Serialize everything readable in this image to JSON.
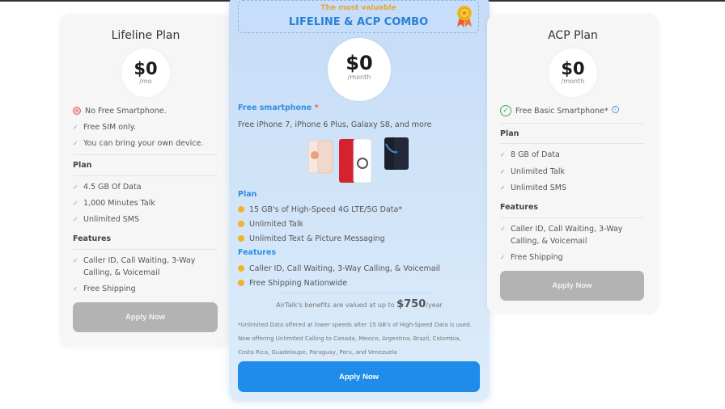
{
  "colors": {
    "accent_blue": "#1e8ce8",
    "label_blue": "#2d8ee0",
    "bullet_orange": "#f0b429",
    "banner_orange": "#e5a43a",
    "disabled_gray": "#b3b3b3",
    "no_red": "#e06060",
    "yes_green": "#3cb043"
  },
  "lifeline": {
    "title": "Lifeline Plan",
    "price": "$0",
    "unit": "/mo",
    "no_phone": "No Free Smartphone.",
    "intro_items": [
      "Free SIM only.",
      "You can bring your own device."
    ],
    "plan_label": "Plan",
    "plan_items": [
      "4.5 GB Of Data",
      "1,000 Minutes Talk",
      "Unlimited SMS"
    ],
    "features_label": "Features",
    "feature_items": [
      "Caller ID, Call Waiting, 3-Way Calling, & Voicemail",
      "Free Shipping"
    ],
    "button": "Apply Now"
  },
  "combo": {
    "banner_sub": "The most valuable",
    "banner_title": "LIFELINE & ACP COMBO",
    "price": "$0",
    "unit": "/month",
    "smartphone_label": "Free smartphone",
    "smartphone_asterisk": "*",
    "smartphone_desc": "Free iPhone 7, iPhone 6 Plus, Galaxy S8, and more",
    "plan_label": "Plan",
    "plan_items": [
      "15 GB's of High-Speed 4G LTE/5G Data*",
      "Unlimited Talk",
      "Unlimited Text & Picture Messaging"
    ],
    "features_label": "Features",
    "feature_items": [
      "Caller ID, Call Waiting, 3-Way Calling, & Voicemail",
      "Free Shipping Nationwide"
    ],
    "value_prefix": "AirTalk's benefits are valued at up to",
    "value_amount": "$750",
    "value_suffix": "/year",
    "footnote_1": "*Unlimited Data offered at lower speeds after 15 GB's of High-Speed Data is used.",
    "footnote_2": "Now offering Unlimited Calling to Canada, Mexico, Argentina, Brazil, Colombia,",
    "footnote_3": "Costa Rica, Guadeloupe, Paraguay, Peru, and Venezuela",
    "button": "Apply Now"
  },
  "acp": {
    "title": "ACP Plan",
    "price": "$0",
    "unit": "/month",
    "phone": "Free Basic Smartphone*",
    "plan_label": "Plan",
    "plan_items": [
      "8 GB of Data",
      "Unlimited Talk",
      "Unlimited SMS"
    ],
    "features_label": "Features",
    "feature_items": [
      "Caller ID, Call Waiting, 3-Way Calling, & Voicemail",
      "Free Shipping"
    ],
    "button": "Apply Now"
  }
}
